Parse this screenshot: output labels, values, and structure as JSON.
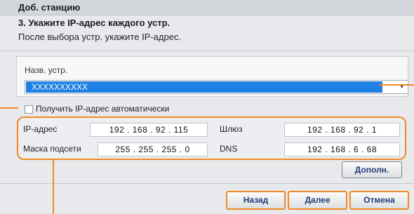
{
  "dialog": {
    "title": "Доб. станцию",
    "step": "3. Укажите IP-адрес каждого устр.",
    "subtitle": "После выбора устр. укажите IP-адрес."
  },
  "device": {
    "label": "Назв. устр.",
    "selected": "XXXXXXXXXX"
  },
  "auto_ip": {
    "label": "Получить IP-адрес автоматически",
    "checked": false
  },
  "network": {
    "ip_label": "IP-адрес",
    "ip_value": "192 . 168 . 92 . 115",
    "gateway_label": "Шлюз",
    "gateway_value": "192 . 168 . 92 . 1",
    "mask_label": "Маска подсети",
    "mask_value": "255 . 255 . 255 . 0",
    "dns_label": "DNS",
    "dns_value": "192 . 168 . 6 . 68"
  },
  "buttons": {
    "advanced": "Дополн.",
    "back": "Назад",
    "next": "Далее",
    "cancel": "Отмена"
  },
  "colors": {
    "highlight": "#f08a24",
    "selection": "#1e7fe4"
  }
}
